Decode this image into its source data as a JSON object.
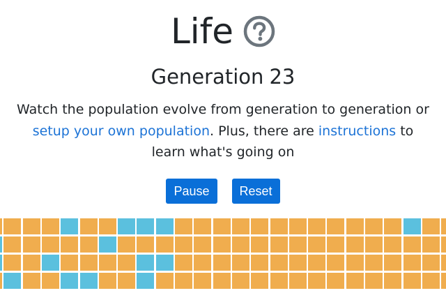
{
  "header": {
    "title": "Life",
    "help_icon": "question-circle-icon",
    "icon_color": "#6c757d"
  },
  "status": {
    "generation_label": "Generation",
    "generation_number": "23"
  },
  "description": {
    "text_1": "Watch the population evolve from generation to generation or ",
    "link_setup": "setup your own population",
    "text_2": ". Plus, there are ",
    "link_instructions": "instructions",
    "text_3": " to learn what's going on"
  },
  "controls": {
    "pause_label": "Pause",
    "reset_label": "Reset",
    "button_color": "#0a6fd8"
  },
  "board": {
    "dead_color": "#f0ad4e",
    "alive_color": "#5bc0de",
    "grid_line_color": "#ffffff",
    "rows": [
      "0000100111000000000000100",
      "1000001000000000000000000",
      "1001000011000000000000000",
      "0100110010000000000000000"
    ]
  }
}
